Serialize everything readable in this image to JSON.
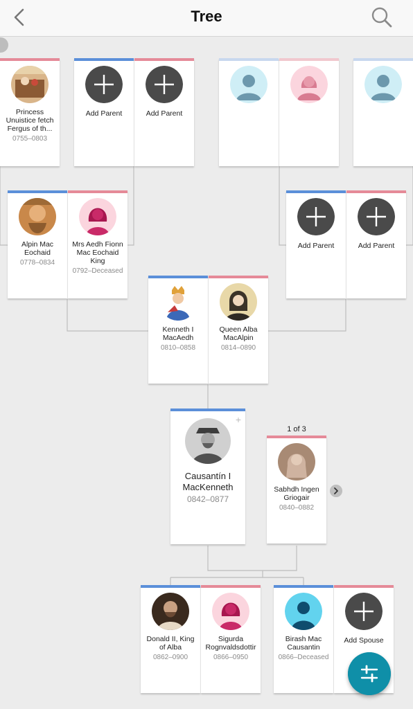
{
  "header": {
    "title": "Tree"
  },
  "people": {
    "p1": {
      "name": "Princess Unuistice fetch Fergus of th...",
      "dates": "0755–0803"
    },
    "alpin": {
      "name": "Alpin Mac Eochaid",
      "dates": "0778–0834"
    },
    "aedh": {
      "name": "Mrs Aedh Fionn Mac Eochaid King",
      "dates": "0792–Deceased"
    },
    "kenneth": {
      "name": "Kenneth I MacAedh",
      "dates": "0810–0858"
    },
    "alba": {
      "name": "Queen Alba MacAlpin",
      "dates": "0814–0890"
    },
    "causantin": {
      "name": "Causantín I MacKenneth",
      "dates": "0842–0877"
    },
    "sabhdh": {
      "name": "Sabhdh Ingen Griogair",
      "dates": "0840–0882"
    },
    "donald": {
      "name": "Donald II, King of Alba",
      "dates": "0862–0900"
    },
    "sigurda": {
      "name": "Sigurda Rognvaldsdottir",
      "dates": "0866–0950"
    },
    "birash": {
      "name": "Birash Mac Causantin",
      "dates": "0866–Deceased"
    }
  },
  "labels": {
    "add_parent": "Add Parent",
    "add_spouse": "Add Spouse",
    "spouse_counter": "1 of 3"
  },
  "colors": {
    "male": "#5b8fd9",
    "female": "#e58a98",
    "fab": "#0f8fa8",
    "placeholder_add": "#4a4a4a"
  },
  "icons": [
    "back-chevron-icon",
    "search-icon",
    "add-icon",
    "male-silhouette-icon",
    "female-silhouette-icon",
    "filter-sliders-icon",
    "chevron-right-icon"
  ]
}
